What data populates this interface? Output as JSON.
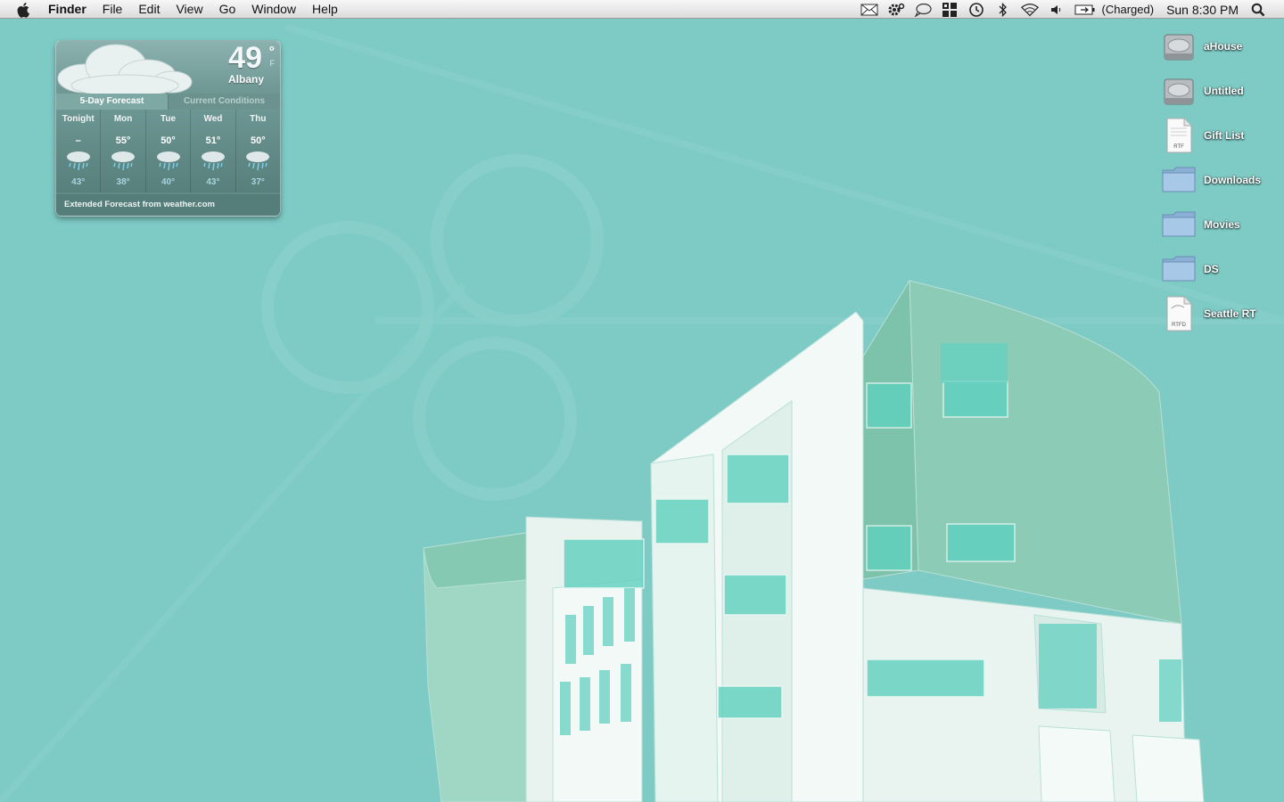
{
  "menubar": {
    "apple_icon": "apple-logo-icon",
    "app_name": "Finder",
    "menus": [
      "File",
      "Edit",
      "View",
      "Go",
      "Window",
      "Help"
    ],
    "status_icons": [
      "mail-icon",
      "gear-icon",
      "speech-bubble-icon",
      "spaces-icon",
      "time-machine-icon",
      "bluetooth-icon",
      "wifi-icon",
      "volume-icon",
      "battery-icon"
    ],
    "battery_status": "(Charged)",
    "clock": "Sun 8:30 PM",
    "spotlight_icon": "spotlight-search-icon"
  },
  "weather_widget": {
    "temperature": "49",
    "degree_symbol": "°",
    "unit": "F",
    "city": "Albany",
    "tabs": [
      "5-Day Forecast",
      "Current Conditions"
    ],
    "active_tab": "5-Day Forecast",
    "forecast": [
      {
        "day": "Tonight",
        "high": "–",
        "low": "43°",
        "condition": "rain-icon"
      },
      {
        "day": "Mon",
        "high": "55°",
        "low": "38°",
        "condition": "rain-icon"
      },
      {
        "day": "Tue",
        "high": "50°",
        "low": "40°",
        "condition": "rain-icon"
      },
      {
        "day": "Wed",
        "high": "51°",
        "low": "43°",
        "condition": "rain-icon"
      },
      {
        "day": "Thu",
        "high": "50°",
        "low": "37°",
        "condition": "rain-icon"
      }
    ],
    "footer": "Extended Forecast from weather.com"
  },
  "desktop_icons": [
    {
      "label": "aHouse",
      "type": "hard-drive-icon"
    },
    {
      "label": "Untitled",
      "type": "hard-drive-icon"
    },
    {
      "label": "Gift List",
      "type": "document-icon",
      "badge": "RTF"
    },
    {
      "label": "Downloads",
      "type": "folder-icon"
    },
    {
      "label": "Movies",
      "type": "folder-icon"
    },
    {
      "label": "DS",
      "type": "folder-icon"
    },
    {
      "label": "Seattle RT",
      "type": "document-icon",
      "badge": "RTFD"
    }
  ],
  "colors": {
    "desktop_background": "#7ecac5",
    "building_main": "#eef7f3",
    "building_accent": "#8fcdb8",
    "glass": "#5fd1bf"
  }
}
